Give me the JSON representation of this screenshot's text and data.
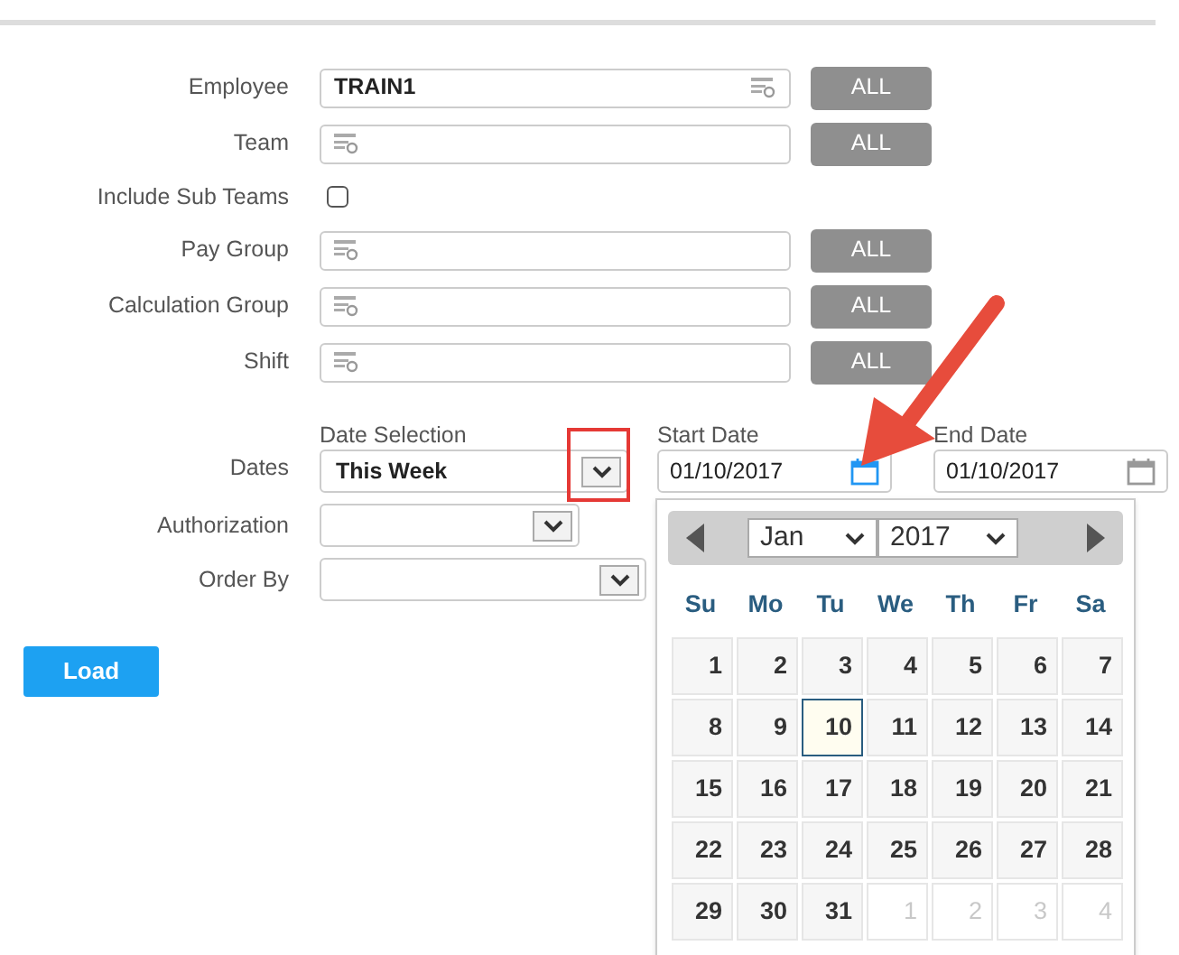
{
  "fields": [
    {
      "kind": "lookup",
      "label": "Employee",
      "value": "TRAIN1",
      "button": "ALL"
    },
    {
      "kind": "lookup",
      "label": "Team",
      "button": "ALL"
    },
    {
      "kind": "checkbox",
      "label": "Include Sub Teams",
      "checked": false
    },
    {
      "kind": "lookup",
      "label": "Pay Group",
      "button": "ALL"
    },
    {
      "kind": "lookup",
      "label": "Calculation Group",
      "button": "ALL"
    },
    {
      "kind": "lookup",
      "label": "Shift",
      "button": "ALL"
    },
    {
      "kind": "dates",
      "label": "Dates",
      "selection_label": "Date Selection",
      "selection": "This Week",
      "start_label": "Start Date",
      "start": "01/10/2017",
      "end_label": "End Date",
      "end": "01/10/2017"
    },
    {
      "kind": "select",
      "label": "Authorization"
    },
    {
      "kind": "select",
      "label": "Order By"
    }
  ],
  "load_button": "Load",
  "calendar": {
    "month": "Jan",
    "year": "2017",
    "weekdays": [
      "Su",
      "Mo",
      "Tu",
      "We",
      "Th",
      "Fr",
      "Sa"
    ],
    "days": [
      {
        "label": "1",
        "in_month": true,
        "selected": false
      },
      {
        "label": "2",
        "in_month": true,
        "selected": false
      },
      {
        "label": "3",
        "in_month": true,
        "selected": false
      },
      {
        "label": "4",
        "in_month": true,
        "selected": false
      },
      {
        "label": "5",
        "in_month": true,
        "selected": false
      },
      {
        "label": "6",
        "in_month": true,
        "selected": false
      },
      {
        "label": "7",
        "in_month": true,
        "selected": false
      },
      {
        "label": "8",
        "in_month": true,
        "selected": false
      },
      {
        "label": "9",
        "in_month": true,
        "selected": false
      },
      {
        "label": "10",
        "in_month": true,
        "selected": true
      },
      {
        "label": "11",
        "in_month": true,
        "selected": false
      },
      {
        "label": "12",
        "in_month": true,
        "selected": false
      },
      {
        "label": "13",
        "in_month": true,
        "selected": false
      },
      {
        "label": "14",
        "in_month": true,
        "selected": false
      },
      {
        "label": "15",
        "in_month": true,
        "selected": false
      },
      {
        "label": "16",
        "in_month": true,
        "selected": false
      },
      {
        "label": "17",
        "in_month": true,
        "selected": false
      },
      {
        "label": "18",
        "in_month": true,
        "selected": false
      },
      {
        "label": "19",
        "in_month": true,
        "selected": false
      },
      {
        "label": "20",
        "in_month": true,
        "selected": false
      },
      {
        "label": "21",
        "in_month": true,
        "selected": false
      },
      {
        "label": "22",
        "in_month": true,
        "selected": false
      },
      {
        "label": "23",
        "in_month": true,
        "selected": false
      },
      {
        "label": "24",
        "in_month": true,
        "selected": false
      },
      {
        "label": "25",
        "in_month": true,
        "selected": false
      },
      {
        "label": "26",
        "in_month": true,
        "selected": false
      },
      {
        "label": "27",
        "in_month": true,
        "selected": false
      },
      {
        "label": "28",
        "in_month": true,
        "selected": false
      },
      {
        "label": "29",
        "in_month": true,
        "selected": false
      },
      {
        "label": "30",
        "in_month": true,
        "selected": false
      },
      {
        "label": "31",
        "in_month": true,
        "selected": false
      },
      {
        "label": "1",
        "in_month": false,
        "selected": false
      },
      {
        "label": "2",
        "in_month": false,
        "selected": false
      },
      {
        "label": "3",
        "in_month": false,
        "selected": false
      },
      {
        "label": "4",
        "in_month": false,
        "selected": false
      }
    ]
  }
}
